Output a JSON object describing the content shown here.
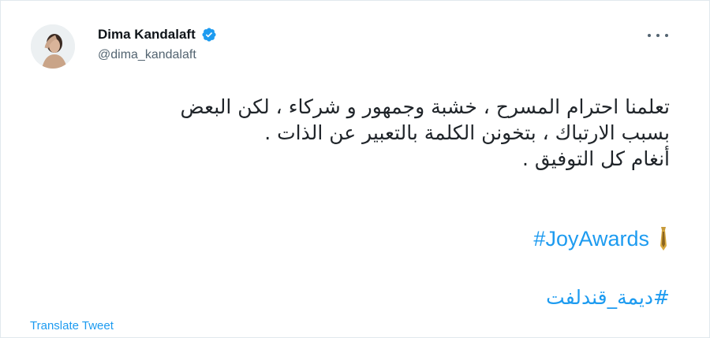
{
  "author": {
    "display_name": "Dima Kandalaft",
    "handle": "@dima_kandalaft",
    "verified": true
  },
  "tweet": {
    "lines": [
      "تعلمنا احترام المسرح ، خشبة وجمهور و شركاء ، لكن البعض",
      "بسبب الارتباك ، بتخونن الكلمة بالتعبير عن الذات .",
      "أنغام كل التوفيق ."
    ],
    "hashtags": [
      "#JoyAwards",
      "#ديمة_قندلفت"
    ]
  },
  "actions": {
    "translate_label": "Translate Tweet"
  },
  "icons": {
    "more": "more-horizontal-icon",
    "verified": "verified-badge-icon",
    "award": "trophy-tie-icon"
  },
  "colors": {
    "link": "#1d9bf0",
    "secondary_text": "#536471",
    "primary_text": "#0f1419",
    "border": "#e1e8ed"
  }
}
